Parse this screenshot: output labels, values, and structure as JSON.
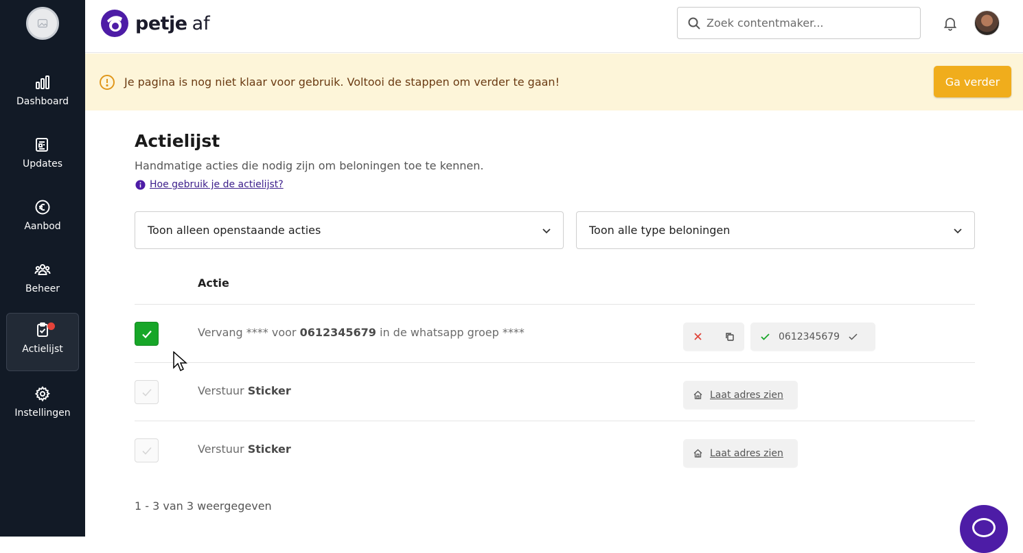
{
  "sidebar": {
    "items": [
      {
        "label": "Dashboard",
        "icon": "bar-chart-icon"
      },
      {
        "label": "Updates",
        "icon": "newspaper-icon"
      },
      {
        "label": "Aanbod",
        "icon": "euro-icon"
      },
      {
        "label": "Beheer",
        "icon": "users-icon"
      },
      {
        "label": "Actielijst",
        "icon": "clipboard-check-icon",
        "active": true,
        "has_notification": true
      },
      {
        "label": "Instellingen",
        "icon": "gear-icon"
      }
    ]
  },
  "header": {
    "brand_name": "petje",
    "brand_suffix": "af",
    "search_placeholder": "Zoek contentmaker..."
  },
  "banner": {
    "message": "Je pagina is nog niet klaar voor gebruik. Voltooi de stappen om verder te gaan!",
    "button_label": "Ga verder"
  },
  "page": {
    "title": "Actielijst",
    "subtitle": "Handmatige acties die nodig zijn om beloningen toe te kennen.",
    "help_link": "Hoe gebruik je de actielijst?"
  },
  "filters": {
    "status_selected": "Toon alleen openstaande acties",
    "type_selected": "Toon alle type beloningen"
  },
  "table": {
    "header": "Actie",
    "rows": [
      {
        "checked": true,
        "pre": "Vervang **** voor ",
        "bold": "0612345679",
        "post": " in de whatsapp groep ****",
        "value_chip": "0612345679"
      },
      {
        "checked": false,
        "pre": "Verstuur ",
        "bold": "Sticker",
        "post": "",
        "address_link": "Laat adres zien"
      },
      {
        "checked": false,
        "pre": "Verstuur ",
        "bold": "Sticker",
        "post": "",
        "address_link": "Laat adres zien"
      }
    ]
  },
  "pagination": {
    "summary": "1 - 3 van 3 weergegeven"
  },
  "colors": {
    "sidebar_bg": "#121a26",
    "brand_purple": "#4d1ca6",
    "banner_bg": "#fdf5d9",
    "banner_button": "#f0ad1c",
    "check_green": "#17a628"
  }
}
